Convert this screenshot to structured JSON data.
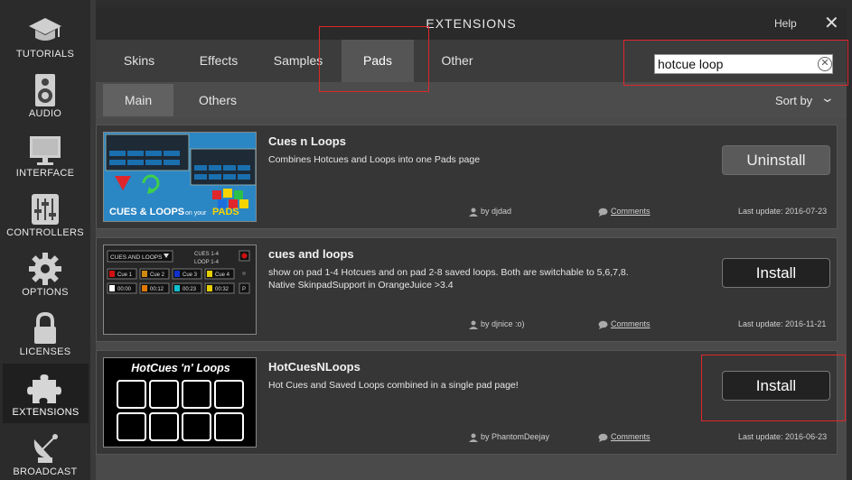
{
  "sidebar": {
    "items": [
      {
        "label": "TUTORIALS",
        "icon": "graduation-cap-icon"
      },
      {
        "label": "AUDIO",
        "icon": "speaker-icon"
      },
      {
        "label": "INTERFACE",
        "icon": "monitor-icon"
      },
      {
        "label": "CONTROLLERS",
        "icon": "mixer-faders-icon"
      },
      {
        "label": "OPTIONS",
        "icon": "gear-icon"
      },
      {
        "label": "LICENSES",
        "icon": "lock-icon"
      },
      {
        "label": "EXTENSIONS",
        "icon": "puzzle-icon"
      },
      {
        "label": "BROADCAST",
        "icon": "satellite-dish-icon"
      }
    ],
    "active": "EXTENSIONS"
  },
  "window": {
    "title": "EXTENSIONS",
    "help_label": "Help",
    "close_glyph": "✕"
  },
  "tabs": [
    {
      "label": "Skins"
    },
    {
      "label": "Effects"
    },
    {
      "label": "Samples"
    },
    {
      "label": "Pads"
    },
    {
      "label": "Other"
    }
  ],
  "active_tab": "Pads",
  "search": {
    "value": "hotcue loop",
    "placeholder": ""
  },
  "subtabs": [
    {
      "label": "Main"
    },
    {
      "label": "Others"
    }
  ],
  "sort_label": "Sort by",
  "extensions": [
    {
      "title": "Cues n Loops",
      "description": "Combines Hotcues and Loops into one Pads page",
      "author": "by djdad",
      "comments": "Comments",
      "last_update": "Last update: 2016-07-23",
      "button": "Uninstall",
      "thumb_text": "CUES & LOOPS on your PADS"
    },
    {
      "title": "cues and loops",
      "description": "show on pad 1-4 Hotcues and on pad 2-8 saved loops. Both are switchable to 5,6,7,8. Native SkinpadSupport in OrangeJuice >3.4",
      "author": "by djnice :o)",
      "comments": "Comments",
      "last_update": "Last update: 2016-11-21",
      "button": "Install",
      "thumb_text": "CUES AND LOOPS",
      "thumb_cues": [
        "Cue 1",
        "Cue 2",
        "Cue 3",
        "Cue 4"
      ],
      "thumb_loops": [
        "00:00",
        "00:12",
        "00:23",
        "00:32"
      ],
      "thumb_mode1": "CUES 1-4",
      "thumb_mode2": "LOOP 1-4"
    },
    {
      "title": "HotCuesNLoops",
      "description": "Hot Cues and Saved Loops combined in a single pad page!",
      "author": "by PhantomDeejay",
      "comments": "Comments",
      "last_update": "Last update: 2016-06-23",
      "button": "Install",
      "thumb_text": "HotCues 'n' Loops"
    }
  ],
  "colors": {
    "highlight": "#e0262b",
    "cue_colors": [
      "#d01010",
      "#d08a10",
      "#1030d0",
      "#e6d000"
    ],
    "loop_colors": [
      "#ffffff",
      "#e07800",
      "#10c0d0",
      "#e6d000"
    ]
  }
}
